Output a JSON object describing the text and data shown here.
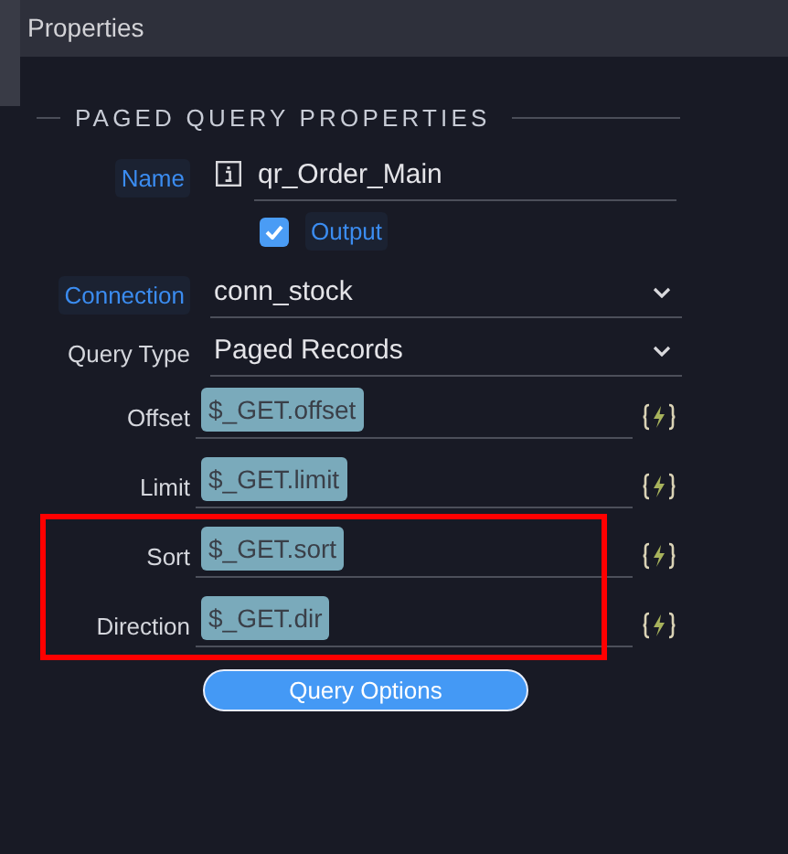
{
  "panel": {
    "title": "Properties"
  },
  "section": {
    "title": "PAGED QUERY PROPERTIES"
  },
  "rows": [
    {
      "kind": "text",
      "label": "Name",
      "accent": true,
      "value": "qr_Order_Main",
      "highlighted": false
    },
    {
      "kind": "checkbox",
      "label": "Output",
      "accent": true,
      "checked": true,
      "highlighted": false
    },
    {
      "kind": "select",
      "label": "Connection",
      "accent": true,
      "value": "conn_stock",
      "highlighted": false
    },
    {
      "kind": "select",
      "label": "Query Type",
      "accent": false,
      "value": "Paged Records",
      "highlighted": false
    },
    {
      "kind": "binding",
      "label": "Offset",
      "accent": false,
      "value": "$_GET.offset",
      "highlighted": false
    },
    {
      "kind": "binding",
      "label": "Limit",
      "accent": false,
      "value": "$_GET.limit",
      "highlighted": false
    },
    {
      "kind": "binding",
      "label": "Sort",
      "accent": false,
      "value": "$_GET.sort",
      "highlighted": true
    },
    {
      "kind": "binding",
      "label": "Direction",
      "accent": false,
      "value": "$_GET.dir",
      "highlighted": true
    }
  ],
  "button": {
    "label": "Query Options"
  }
}
